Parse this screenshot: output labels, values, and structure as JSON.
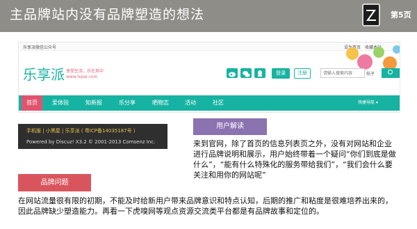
{
  "slide": {
    "title": "主品牌站内没有品牌塑造的想法",
    "page": "第5页",
    "logo_icon": "z-logo-icon"
  },
  "website": {
    "topbar_left": "乐享派微信公众号",
    "topbar_right": "设为首页",
    "topbar_fav": "收藏本站",
    "brand": "乐享派",
    "slogan": "享受生活，乐在其中",
    "domain": "www.lxpai.com",
    "social_icons": [
      "weibo-icon",
      "wechat-icon",
      "qq-icon"
    ],
    "login": "登录",
    "register": "注册",
    "search_placeholder": "请输入搜索内容",
    "search_category": "帖子",
    "nav": [
      "首页",
      "爱体验",
      "知新报",
      "乐分享",
      "晒物志",
      "活动",
      "社区"
    ],
    "nav_right": "快捷导航 ▾",
    "active_nav_color": "#e1546d",
    "accent": "#17b3a2"
  },
  "footer": {
    "line1": "手机版 | 小黑屋 | 乐享派 ( 粤ICP备14035187号 )",
    "line2": "Powered by Discuz! X3.2 © 2001-2013 Comsenz Inc."
  },
  "sections": {
    "user_tag": "用户解读",
    "user_text": "来到官网，除了首页的信息列表页之外，没有对网站和企业进行品牌说明和展示，用户始终带着一个疑问“你们到底是做什么”，“能有什么特殊化的服务带给我们”，“我们会什么要关注和用你的网站呢”",
    "brand_tag": "品牌问题",
    "brand_text": "在网站流量很有限的初期，不能及时给新用户带来品牌意识和特点认知，后期的推广和粘度是很难培养出来的，因此品牌缺少塑造能力。再看一下虎嗅网等观点资源交流类平台都是有品牌故事和定位的。"
  }
}
